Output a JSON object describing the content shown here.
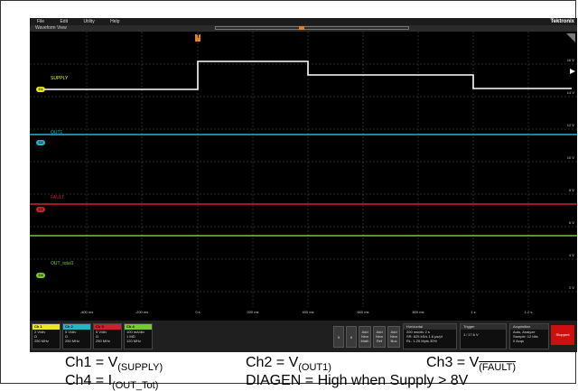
{
  "menu": {
    "items": [
      "File",
      "Edit",
      "Utility",
      "Help"
    ],
    "brand": "Tektronix"
  },
  "window": {
    "title": "Waveform View"
  },
  "colors": {
    "ch1": "#e8e820",
    "ch2": "#20b8c8",
    "ch3": "#d02030",
    "ch4": "#78c830",
    "trigger": "#e08020"
  },
  "channels": [
    {
      "badge": "C1",
      "label": "SUPPLY"
    },
    {
      "badge": "C2",
      "label": "OUT1"
    },
    {
      "badge": "C3",
      "label": "FAULT"
    },
    {
      "badge": "C4",
      "label": "OUT_total1"
    }
  ],
  "vticks": [
    "16 V",
    "14 V",
    "12 V",
    "10 V",
    "8 V",
    "6 V",
    "4 V",
    "2 V"
  ],
  "hticks": [
    "-400 ms",
    "-200 ms",
    "0 s",
    "200 ms",
    "400 ms",
    "600 ms",
    "800 ms",
    "1 s",
    "1.2 s"
  ],
  "trigger_marker": "T",
  "status": {
    "ch1": {
      "head": "Ch 1",
      "lines": [
        "2 V/div",
        "Ω",
        "250 MHz"
      ]
    },
    "ch2": {
      "head": "Ch 2",
      "lines": [
        "5 V/div",
        "Ω",
        "250 MHz"
      ]
    },
    "ch3": {
      "head": "Ch 3",
      "lines": [
        "5 V/div",
        "Ω",
        "250 MHz"
      ]
    },
    "ch4": {
      "head": "Ch 4",
      "lines": [
        "100 mA/div",
        "1 MΩ",
        "120 MHz"
      ]
    },
    "buttons": [
      "5",
      "6",
      "Add New Math",
      "Add New Ref",
      "Add New Bus"
    ],
    "horizontal": {
      "head": "Horizontal",
      "lines": [
        "200 ms/div    2 s",
        "SR: 625 kS/s    1.6 µs/pt",
        "RL: 1.25 Mpts    30%"
      ]
    },
    "trigger": {
      "head": "Trigger",
      "lines": [
        "1  ⁄  17.6 V"
      ]
    },
    "acquisition": {
      "head": "Acquisition",
      "lines": [
        "Auto,    Analyze",
        "Sample: 12 bits",
        "0 Acqs"
      ]
    },
    "stopped": "Stopped"
  },
  "notes": {
    "n1_main": "Ch1 = V",
    "n1_sub": "(SUPPLY)",
    "n2_main": "Ch2 = V",
    "n2_sub": "(OUT1)",
    "n3_main": "Ch3 = V",
    "n3_sub": "(FAULT)",
    "n4_main": "Ch4 = I",
    "n4_sub": "(OUT_Tot)",
    "n5": "DIAGEN = High when Supply > 8V"
  }
}
